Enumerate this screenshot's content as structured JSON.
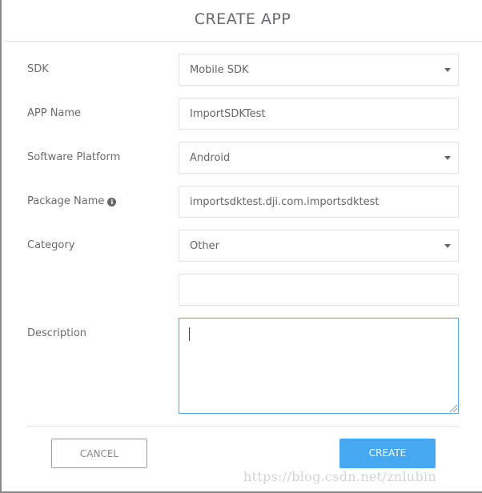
{
  "dialog": {
    "title": "CREATE APP"
  },
  "form": {
    "sdk": {
      "label": "SDK",
      "value": "Mobile SDK"
    },
    "app_name": {
      "label": "APP Name",
      "value": "ImportSDKTest"
    },
    "software_platform": {
      "label": "Software Platform",
      "value": "Android"
    },
    "package_name": {
      "label": "Package Name",
      "value": "importsdktest.dji.com.importsdktest",
      "info_icon": "info-circle-icon"
    },
    "category": {
      "label": "Category",
      "value": "Other"
    },
    "category_other": {
      "value": ""
    },
    "description": {
      "label": "Description",
      "value": ""
    }
  },
  "footer": {
    "cancel_label": "CANCEL",
    "create_label": "CREATE"
  },
  "watermark": "https://blog.csdn.net/znlubin",
  "colors": {
    "accent": "#45a8f0",
    "focus_border": "#56a7de",
    "label_text": "#6b6b6b"
  }
}
